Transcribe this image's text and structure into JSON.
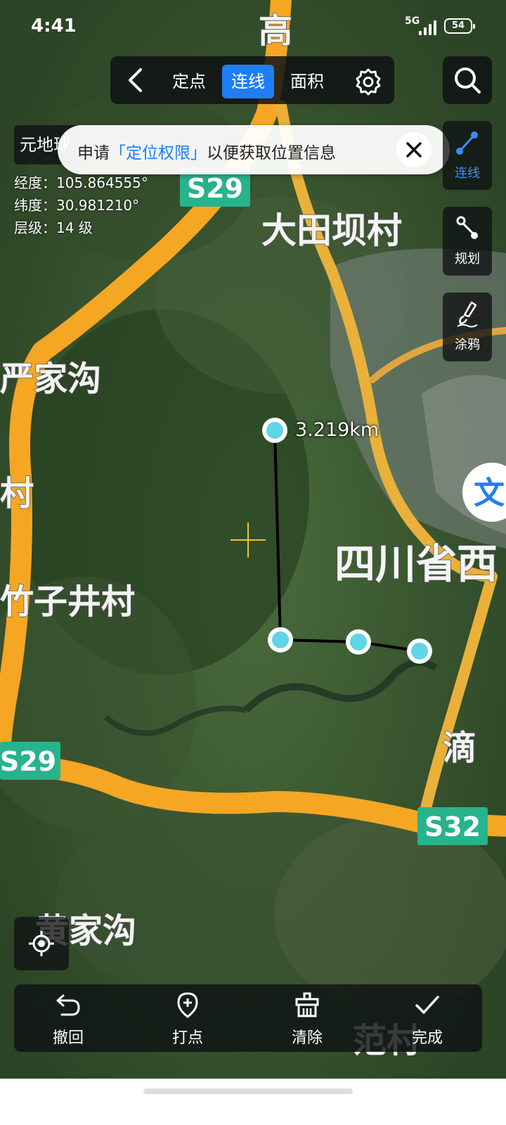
{
  "status_bar": {
    "time": "4:41",
    "network": "5G",
    "battery": "54"
  },
  "toolbar": {
    "tabs": [
      {
        "label": "定点",
        "active": false
      },
      {
        "label": "连线",
        "active": true
      },
      {
        "label": "面积",
        "active": false
      }
    ]
  },
  "info": {
    "brand": "元地球",
    "longitude": "经度：105.864555°",
    "latitude": "纬度：30.981210°",
    "level": "层级：14 级"
  },
  "toast": {
    "prefix": "申请",
    "highlight": "「定位权限」",
    "suffix": "以便获取位置信息"
  },
  "side_tools": [
    {
      "label": "连线",
      "icon": "line-tool-icon",
      "active": true
    },
    {
      "label": "规划",
      "icon": "route-plan-icon",
      "active": false
    },
    {
      "label": "涂鸦",
      "icon": "brush-icon",
      "active": false
    }
  ],
  "measurement": {
    "distance": "3.219km"
  },
  "map_labels": {
    "gao": "高",
    "s29_top": "S29",
    "datianba": "大田坝村",
    "yanjiagou": "严家沟",
    "cun_left": "村",
    "zhuzijing": "竹子井村",
    "sichuan": "四川省西",
    "s29_left": "S29",
    "s32": "S32",
    "di": "滴",
    "huangjiagou": "黄家沟",
    "fangcun": "范村",
    "wen_marker": "文"
  },
  "bottom_bar": {
    "undo": "撤回",
    "add_point": "打点",
    "clear": "清除",
    "done": "完成"
  },
  "colors": {
    "accent": "#1f7ef7",
    "road": "#f5a623",
    "route_shield": "#27b38b",
    "measure_point": "#5fd6e6"
  }
}
